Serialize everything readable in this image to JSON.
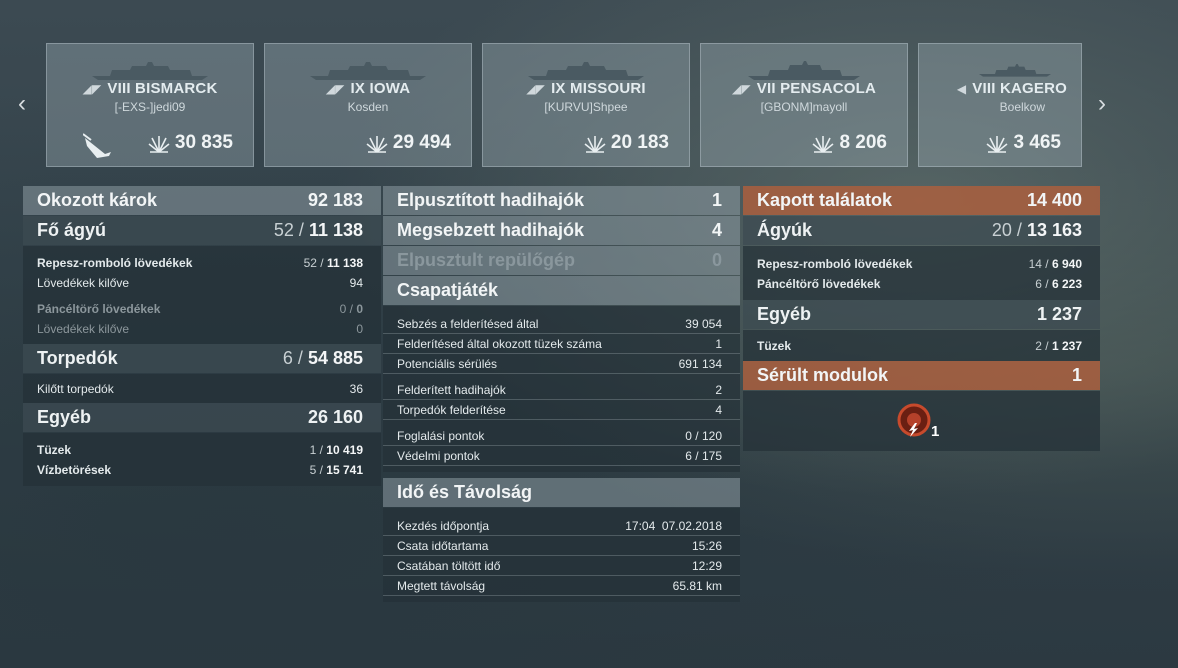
{
  "nav": {
    "prev_icon": "chevron-left-icon",
    "next_icon": "chevron-right-icon",
    "prev_glyph": "‹",
    "next_glyph": "›"
  },
  "ships": [
    {
      "cls": "◢◤",
      "title": "VIII BISMARCK",
      "player": "[-EXS-]jedi09",
      "damage": "30 835",
      "sunk": true
    },
    {
      "cls": "◢◤",
      "title": "IX IOWA",
      "player": "Kosden",
      "damage": "29 494",
      "sunk": false
    },
    {
      "cls": "◢◤",
      "title": "IX MISSOURI",
      "player": "[KURVU]Shpee",
      "damage": "20 183",
      "sunk": false
    },
    {
      "cls": "◢◤",
      "title": "VII PENSACOLA",
      "player": "[GBONM]mayoll",
      "damage": "8 206",
      "sunk": false
    },
    {
      "cls": "◀",
      "title": "VIII KAGERO",
      "player": "Boelkow",
      "damage": "3 465",
      "sunk": false
    }
  ],
  "damage_dealt": {
    "header": {
      "label": "Okozott károk",
      "value": "92 183"
    },
    "main_guns": {
      "label": "Fő ágyú",
      "hits": "52",
      "total": "11 138"
    },
    "he": {
      "label": "Repesz-romboló lövedékek",
      "hits": "52",
      "total": "11 138"
    },
    "he_fired": {
      "label": "Lövedékek kilőve",
      "value": "94"
    },
    "ap": {
      "label": "Páncéltörő lövedékek",
      "hits": "0",
      "total": "0"
    },
    "ap_fired": {
      "label": "Lövedékek kilőve",
      "value": "0"
    },
    "torpedoes": {
      "label": "Torpedók",
      "hits": "6",
      "total": "54 885"
    },
    "torps_fired": {
      "label": "Kilőtt torpedók",
      "value": "36"
    },
    "other": {
      "label": "Egyéb",
      "value": "26 160"
    },
    "fires": {
      "label": "Tüzek",
      "hits": "1",
      "total": "10 419"
    },
    "flooding": {
      "label": "Vízbetörések",
      "hits": "5",
      "total": "15 741"
    }
  },
  "results": {
    "destroyed": {
      "label": "Elpusztított hadihajók",
      "value": "1"
    },
    "damaged": {
      "label": "Megsebzett hadihajók",
      "value": "4"
    },
    "planes": {
      "label": "Elpusztult repülőgép",
      "value": "0"
    },
    "teamplay": {
      "label": "Csapatjáték",
      "rows1": [
        {
          "label": "Sebzés a felderítésed által",
          "value": "39 054"
        },
        {
          "label": "Felderítésed által okozott tüzek száma",
          "value": "1"
        },
        {
          "label": "Potenciális sérülés",
          "value": "691 134"
        }
      ],
      "rows2": [
        {
          "label": "Felderített hadihajók",
          "value": "2"
        },
        {
          "label": "Torpedók felderítése",
          "value": "4"
        }
      ],
      "rows3": [
        {
          "label": "Foglalási pontok",
          "value": "0 / 120"
        },
        {
          "label": "Védelmi pontok",
          "value": "6 / 175"
        }
      ]
    },
    "time": {
      "label": "Idő és Távolság",
      "rows": [
        {
          "label": "Kezdés időpontja",
          "value": "17:04  07.02.2018"
        },
        {
          "label": "Csata időtartama",
          "value": "15:26"
        },
        {
          "label": "Csatában töltött idő",
          "value": "12:29"
        },
        {
          "label": "Megtett távolság",
          "value": "65.81 km"
        }
      ]
    }
  },
  "received": {
    "header": {
      "label": "Kapott találatok",
      "value": "14 400"
    },
    "guns": {
      "label": "Ágyúk",
      "hits": "20",
      "total": "13 163"
    },
    "he": {
      "label": "Repesz-romboló lövedékek",
      "hits": "14",
      "total": "6 940"
    },
    "ap": {
      "label": "Páncéltörő lövedékek",
      "hits": "6",
      "total": "6 223"
    },
    "other": {
      "label": "Egyéb",
      "value": "1 237"
    },
    "fires": {
      "label": "Tüzek",
      "hits": "2",
      "total": "1 237"
    },
    "modules": {
      "label": "Sérült modulok",
      "value": "1",
      "icon": "damaged-module-icon",
      "count": "1"
    }
  },
  "sep": "/"
}
